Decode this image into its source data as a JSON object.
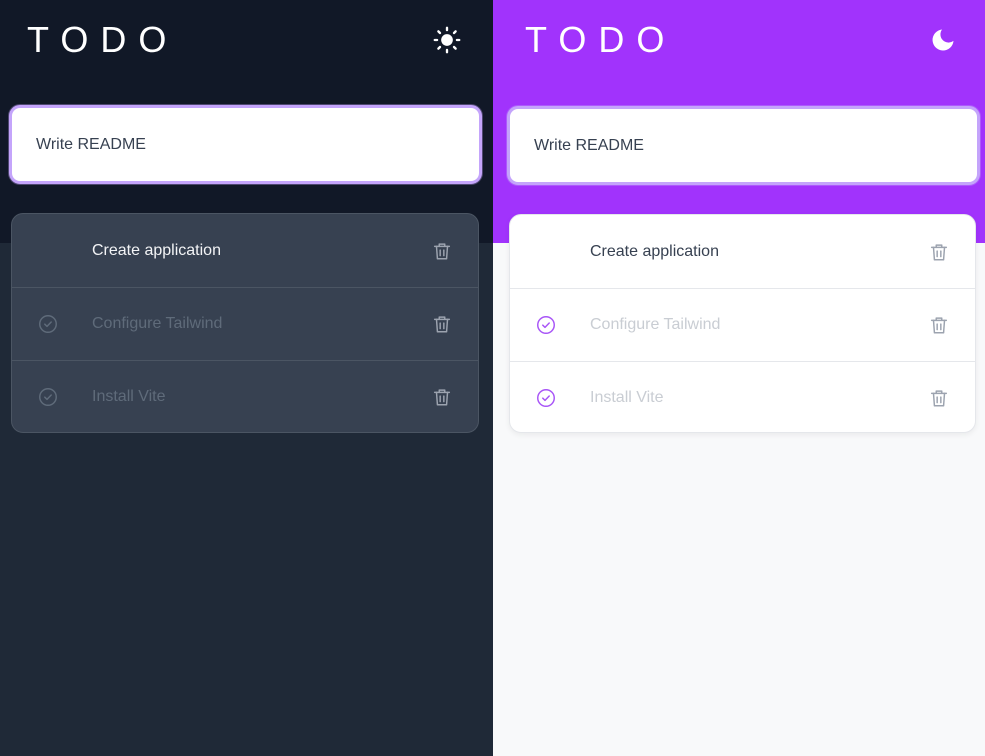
{
  "colors": {
    "dark_background": "#1f2937",
    "dark_header": "#111827",
    "dark_card": "#374151",
    "light_background": "#f8f9fa",
    "light_header": "#a133fc",
    "accent": "#a855f7",
    "input_focus_ring": "#c4a4fb"
  },
  "dark_panel": {
    "theme": "dark",
    "title": "TODO",
    "toggle_icon": "sun-icon",
    "input": {
      "value": "Write README"
    },
    "todos": [
      {
        "label": "Create application",
        "completed": false,
        "check_icon": "",
        "delete_icon": "trash-icon"
      },
      {
        "label": "Configure Tailwind",
        "completed": true,
        "check_icon": "check-circle-icon",
        "delete_icon": "trash-icon"
      },
      {
        "label": "Install Vite",
        "completed": true,
        "check_icon": "check-circle-icon",
        "delete_icon": "trash-icon"
      }
    ]
  },
  "light_panel": {
    "theme": "light",
    "title": "TODO",
    "toggle_icon": "moon-icon",
    "input": {
      "value": "Write README"
    },
    "todos": [
      {
        "label": "Create application",
        "completed": false,
        "check_icon": "",
        "delete_icon": "trash-icon"
      },
      {
        "label": "Configure Tailwind",
        "completed": true,
        "check_icon": "check-circle-icon",
        "delete_icon": "trash-icon"
      },
      {
        "label": "Install Vite",
        "completed": true,
        "check_icon": "check-circle-icon",
        "delete_icon": "trash-icon"
      }
    ]
  }
}
